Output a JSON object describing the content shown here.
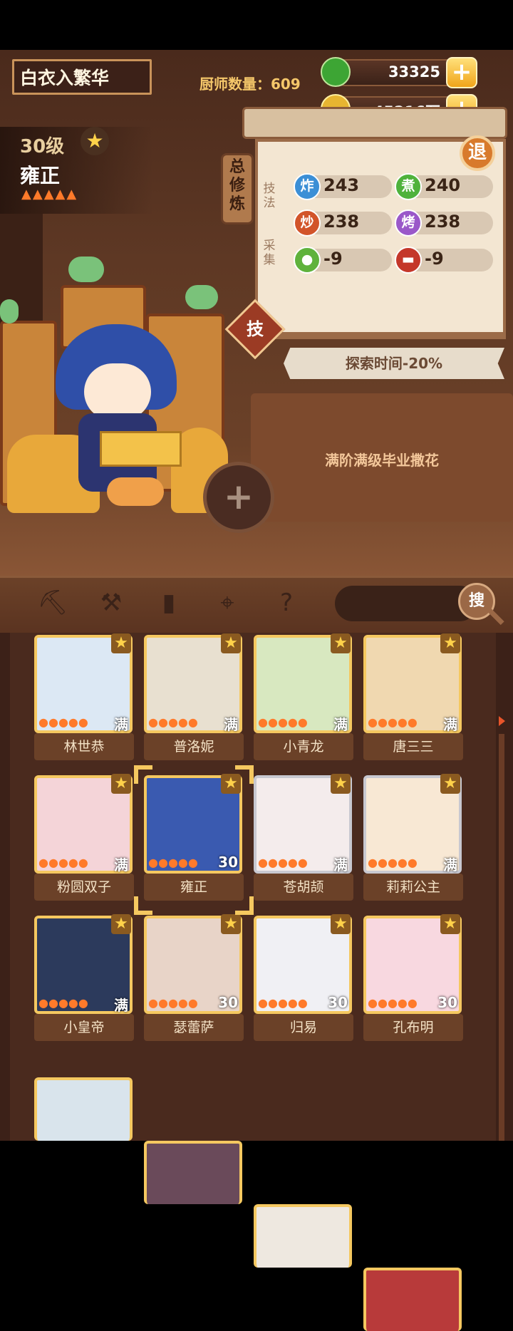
{
  "header": {
    "player_name": "白衣入繁华",
    "chef_count_label": "厨师数量：609",
    "jade_value": "33325",
    "coin_value": "45216万"
  },
  "chef": {
    "level": "30级",
    "name": "雍正",
    "stars_count": 5
  },
  "panel": {
    "side_tab": "总修炼",
    "technique_label": "技法",
    "gather_label": "采集",
    "skills": [
      {
        "icon": "炸",
        "value": "243",
        "color": "#3b8fd6"
      },
      {
        "icon": "煮",
        "value": "240",
        "color": "#4fb23c"
      },
      {
        "icon": "炒",
        "value": "238",
        "color": "#d2542a"
      },
      {
        "icon": "烤",
        "value": "238",
        "color": "#9a58c9"
      }
    ],
    "gather": [
      {
        "icon": "veg-icon",
        "value": "-9",
        "color": "#5fb23c"
      },
      {
        "icon": "meat-icon",
        "value": "-9",
        "color": "#c4372a"
      }
    ],
    "exit_label": "退",
    "skill_button": "技",
    "ribbon_text": "探索时间-20%",
    "memo": "满阶满级毕业撒花"
  },
  "toolbar": {
    "icons": [
      "shovel-icon",
      "fork-icon",
      "jar-icon",
      "location-icon",
      "map-question-icon"
    ],
    "search_label": "搜"
  },
  "cards": [
    {
      "name": "林世恭",
      "level": "满",
      "frame": "gold"
    },
    {
      "name": "普洛妮",
      "level": "满",
      "frame": "gold"
    },
    {
      "name": "小青龙",
      "level": "满",
      "frame": "gold"
    },
    {
      "name": "唐三三",
      "level": "满",
      "frame": "gold"
    },
    {
      "name": "粉圆双子",
      "level": "满",
      "frame": "gold"
    },
    {
      "name": "雍正",
      "level": "30",
      "frame": "gold"
    },
    {
      "name": "苍胡颉",
      "level": "满",
      "frame": "silver"
    },
    {
      "name": "莉莉公主",
      "level": "满",
      "frame": "silver"
    },
    {
      "name": "小皇帝",
      "level": "满",
      "frame": "gold"
    },
    {
      "name": "瑟蕾萨",
      "level": "30",
      "frame": "gold"
    },
    {
      "name": "归易",
      "level": "30",
      "frame": "gold"
    },
    {
      "name": "孔布明",
      "level": "30",
      "frame": "gold"
    }
  ],
  "colors": {
    "gold_frame": "#f5c860",
    "wood_dark": "#3c2118",
    "accent_orange": "#e8552a"
  }
}
